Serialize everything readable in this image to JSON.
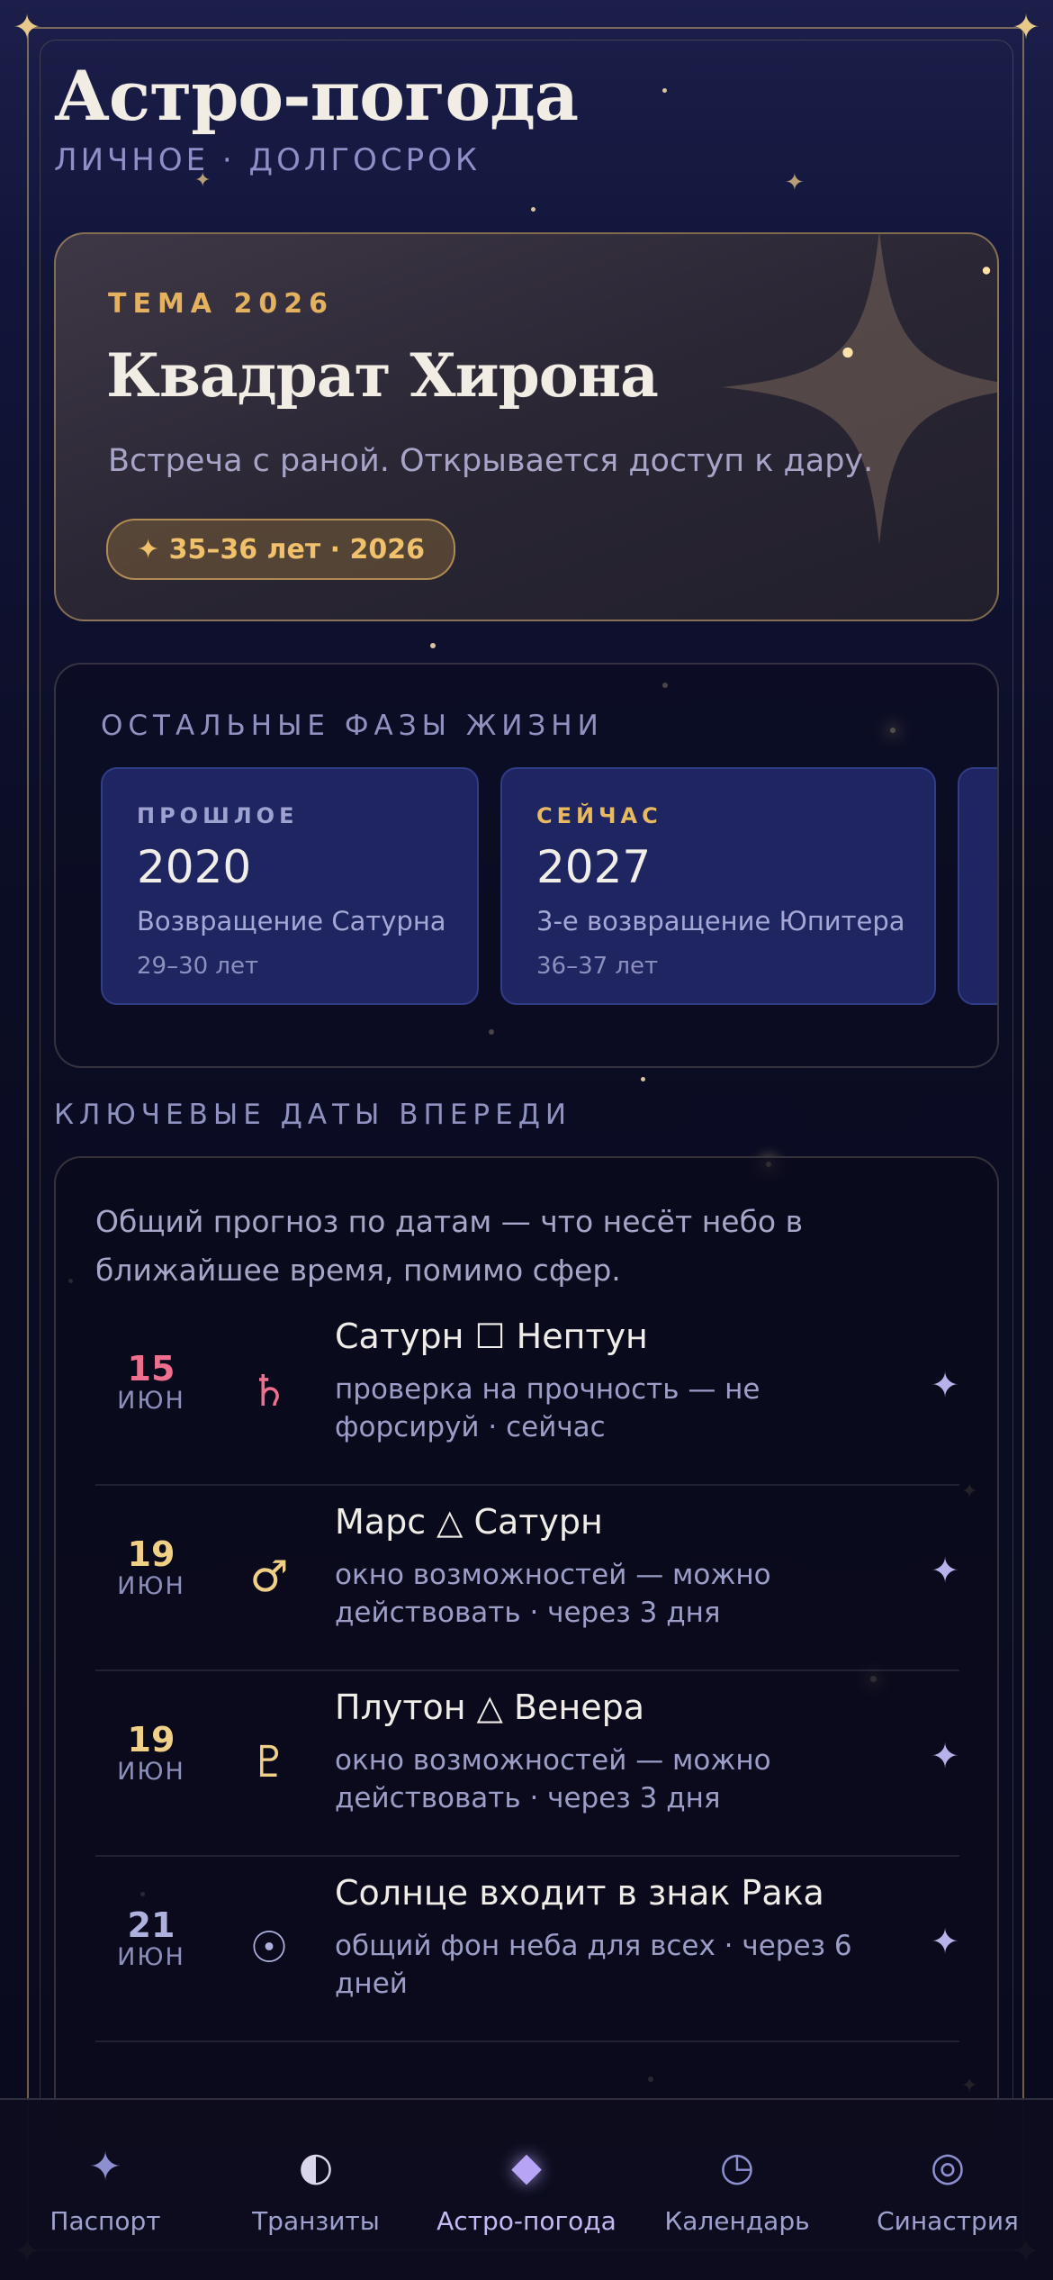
{
  "header": {
    "title": "Астро-погода",
    "subtitle": "ЛИЧНОЕ · ДОЛГОСРОК"
  },
  "theme": {
    "eyebrow": "ТЕМА 2026",
    "title": "Квадрат Хирона",
    "description": "Встреча с раной. Открывается доступ к дару.",
    "badge": "✦ 35–36 лет · 2026"
  },
  "phases": {
    "label": "ОСТАЛЬНЫЕ ФАЗЫ ЖИЗНИ",
    "items": [
      {
        "eyebrow": "ПРОШЛОЕ",
        "year": "2020",
        "name": "Возвращение Сатурна",
        "age": "29–30 лет"
      },
      {
        "eyebrow": "СЕЙЧАС",
        "year": "2027",
        "name": "3-е возвращение Юпитера",
        "age": "36–37 лет"
      }
    ]
  },
  "key_dates": {
    "label": "КЛЮЧЕВЫЕ ДАТЫ ВПЕРЕДИ",
    "intro": "Общий прогноз по датам — что несёт небо в ближайшее время, помимо сфер.",
    "items": [
      {
        "day": "15",
        "month": "ИЮН",
        "glyph": "♄",
        "title": "Сатурн ☐ Нептун",
        "sub": "проверка на прочность — не форсируй · сейчас",
        "day_color": "#ef6f8f",
        "glyph_color": "#ef6f8f",
        "icon": "sparkle-icon"
      },
      {
        "day": "19",
        "month": "ИЮН",
        "glyph": "♂",
        "title": "Марс △ Сатурн",
        "sub": "окно возможностей — можно действовать · через 3 дня",
        "day_color": "#f0cf86",
        "glyph_color": "#f0cf86",
        "icon": "sparkle-icon"
      },
      {
        "day": "19",
        "month": "ИЮН",
        "glyph": "♇",
        "title": "Плутон △ Венера",
        "sub": "окно возможностей — можно действовать · через 3 дня",
        "day_color": "#f0cf86",
        "glyph_color": "#f0cf86",
        "icon": "sparkle-icon"
      },
      {
        "day": "21",
        "month": "ИЮН",
        "glyph": "☉",
        "title": "Солнце входит в знак Рака",
        "sub": "общий фон неба для всех · через 6 дней",
        "day_color": "#aeb1de",
        "glyph_color": "#aeb1de",
        "icon": "sparkle-icon"
      }
    ]
  },
  "tabbar": {
    "items": [
      {
        "label": "Паспорт",
        "icon": "✦",
        "icon_name": "sparkle-icon"
      },
      {
        "label": "Транзиты",
        "icon": "◐",
        "icon_name": "half-moon-icon"
      },
      {
        "label": "Астро-погода",
        "icon": "◆",
        "icon_name": "diamond-icon",
        "active": true
      },
      {
        "label": "Календарь",
        "icon": "◷",
        "icon_name": "clock-icon"
      },
      {
        "label": "Синастрия",
        "icon": "◎",
        "icon_name": "rings-icon"
      }
    ]
  },
  "colors": {
    "accent_gold": "#e4b25e",
    "accent_violet": "#b7a4f5",
    "background": "#0b0d24"
  }
}
